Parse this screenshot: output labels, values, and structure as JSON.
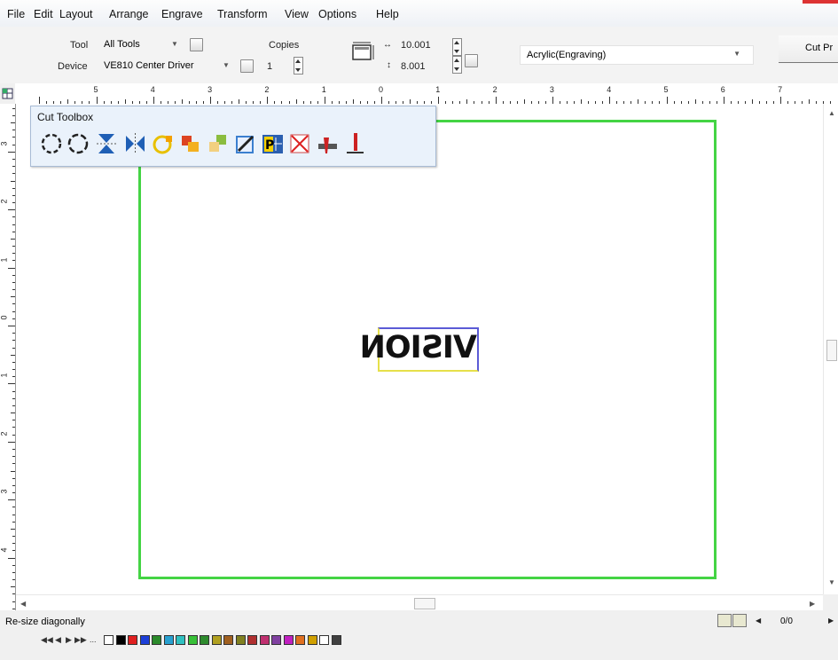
{
  "menu": [
    "File",
    "Edit",
    "Layout",
    "Arrange",
    "Engrave",
    "Transform",
    "View",
    "Options",
    "Help"
  ],
  "toolbar": {
    "tool_label": "Tool",
    "tool_value": "All Tools",
    "device_label": "Device",
    "device_value": "VE810 Center Driver",
    "copies_label": "Copies",
    "copies_value": "1",
    "width_value": "10.001",
    "height_value": "8.001",
    "material_value": "Acrylic(Engraving)",
    "cut_button_label": "Cut Pr",
    "more_button_label": "..."
  },
  "ruler": {
    "h_numbers": [
      "5",
      "4",
      "3",
      "2",
      "1",
      "0",
      "1",
      "2",
      "3",
      "4",
      "5",
      "6",
      "7"
    ],
    "v_numbers": [
      "3",
      "2",
      "1",
      "0",
      "1",
      "2",
      "3",
      "4"
    ]
  },
  "toolbox": {
    "title": "Cut Toolbox",
    "tools": [
      "circle-dashed-icon",
      "circle-dashed-reverse-icon",
      "flip-vertical-icon",
      "flip-horizontal-icon",
      "weld-icon",
      "combine-icon",
      "trim-icon",
      "edit-node-icon",
      "p-mark-icon",
      "cross-icon",
      "knife-icon",
      "blade-depth-icon"
    ]
  },
  "canvas": {
    "object_text": "VISION"
  },
  "colors": {
    "page_border": "#44d444",
    "toolbox_bg": "#eaf2fb"
  },
  "status": {
    "text": "Re-size diagonally",
    "page_counter": "0/0"
  },
  "layers": [
    "p0",
    "p1",
    "p2",
    "p3",
    "p4",
    "p5",
    "p6",
    "p7",
    "p8",
    "p9",
    "p10",
    "p11",
    "p12",
    "p13",
    "p14",
    "p15",
    "p16",
    "p17",
    "p18",
    "p19"
  ]
}
